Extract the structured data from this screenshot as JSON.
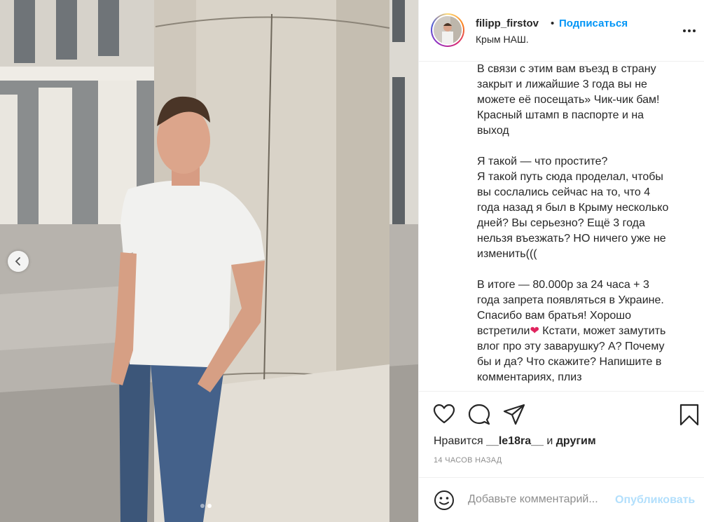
{
  "post": {
    "username": "filipp_firstov",
    "separator": "•",
    "follow_label": "Подписаться",
    "location": "Крым НАШ.",
    "caption_lines": [
      "В связи с этим вам въезд в страну",
      "закрыт и лижайшие 3 года вы не",
      "можете её посещать» Чик-чик бам!",
      "Красный штамп в паспорте и на",
      "выход",
      "",
      "Я такой — что простите?",
      "Я такой путь сюда проделал, чтобы",
      "вы сослались сейчас на то, что 4",
      "года назад я был в Крыму несколько",
      "дней? Вы серьезно? Ещё 3 года",
      "нельзя въезжать? НО ничего уже не",
      "изменить(((",
      "",
      "В итоге — 80.000р за 24 часа + 3",
      "года запрета появляться в Украине.",
      "Спасибо вам братья! Хорошо"
    ],
    "caption_emoji_line_prefix": "встретили",
    "caption_emoji": "❤",
    "caption_emoji_line_suffix": " Кстати, может замутить",
    "caption_tail_lines": [
      "влог про эту заварушку? А? Почему",
      "бы и да? Что скажите? Напишите в",
      "комментариях, плиз"
    ],
    "likes_prefix": "Нравится",
    "likes_user": "__le18ra__",
    "likes_and": "и",
    "likes_others": "другим",
    "timestamp": "14 часов назад",
    "comment_placeholder": "Добавьте комментарий...",
    "publish_label": "Опубликовать"
  },
  "carousel": {
    "dot_count": 2,
    "active_dot": 2
  },
  "icons": {
    "like": "heart-icon",
    "comment": "comment-icon",
    "share": "share-icon",
    "save": "bookmark-icon",
    "more": "more-icon",
    "emoji": "emoji-icon",
    "prev": "chevron-left-icon"
  },
  "colors": {
    "link_blue": "#0095f6",
    "publish_disabled": "#b2dffc",
    "muted": "#8e8e8e",
    "border": "#efefef",
    "text": "#262626"
  }
}
